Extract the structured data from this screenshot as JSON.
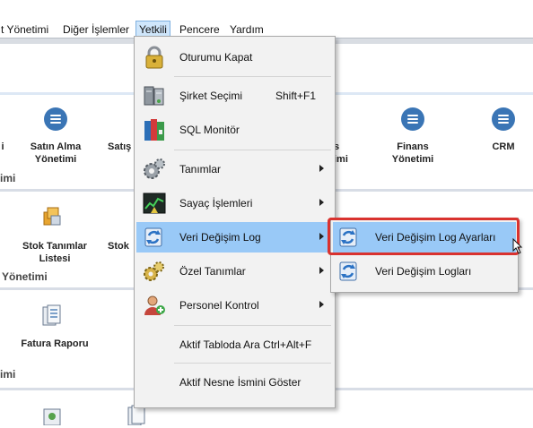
{
  "menubar": {
    "items": [
      {
        "label": "t Yönetimi"
      },
      {
        "label": "Diğer İşlemler"
      },
      {
        "label": "Yetkili"
      },
      {
        "label": "Pencere"
      },
      {
        "label": "Yardım"
      }
    ]
  },
  "background": {
    "tiles_row1": [
      {
        "label": "i"
      },
      {
        "label": "Satın Alma\nYönetimi"
      },
      {
        "label": "Satış"
      },
      {
        "label": "s"
      },
      {
        "label": "Finans\nYönetimi"
      },
      {
        "label": "CRM"
      }
    ],
    "row1_trailing": "imi",
    "sections": [
      {
        "label": "imi"
      },
      {
        "label": "Yönetimi"
      },
      {
        "label": "imi"
      }
    ],
    "tiles_row2": [
      {
        "label": "Stok Tanımlar\nListesi"
      },
      {
        "label": "Stok"
      }
    ],
    "tiles_row3": [
      {
        "label": "Fatura Raporu"
      }
    ]
  },
  "dropdown": {
    "items": [
      {
        "label": "Oturumu Kapat",
        "icon": "padlock-icon"
      },
      {
        "label": "Şirket Seçimi",
        "shortcut": "Shift+F1",
        "icon": "server-icon"
      },
      {
        "label": "SQL Monitör",
        "icon": "books-icon"
      },
      {
        "label": "Tanımlar",
        "icon": "gears-icon",
        "submenu": true
      },
      {
        "label": "Sayaç İşlemleri",
        "icon": "counter-icon",
        "submenu": true
      },
      {
        "label": "Veri Değişim Log",
        "icon": "sync-log-icon",
        "submenu": true,
        "highlighted": true
      },
      {
        "label": "Özel Tanımlar",
        "icon": "special-gears-icon",
        "submenu": true
      },
      {
        "label": "Personel Kontrol",
        "icon": "personnel-icon",
        "submenu": true
      },
      {
        "label": "Aktif Tabloda Ara Ctrl+Alt+F"
      },
      {
        "label": "Aktif Nesne İsmini Göster"
      }
    ]
  },
  "submenu": {
    "items": [
      {
        "label": "Veri Değişim Log Ayarları",
        "icon": "sync-settings-icon",
        "highlighted": true
      },
      {
        "label": "Veri Değişim Logları",
        "icon": "sync-logs-icon"
      }
    ]
  },
  "colors": {
    "highlight": "#99c9f7",
    "focus_border": "#d9322f",
    "tile_icon": "#3a75b5"
  }
}
